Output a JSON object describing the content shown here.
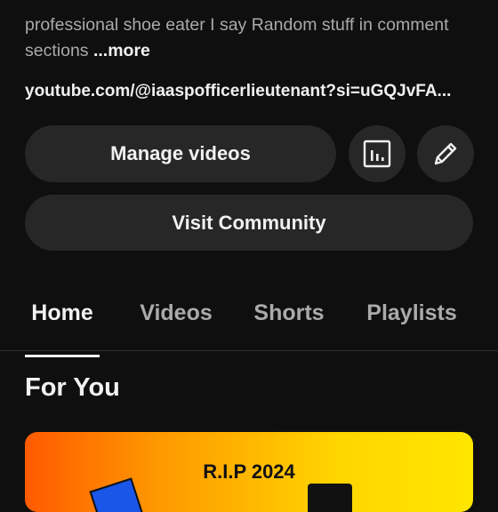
{
  "channel": {
    "description": "professional shoe eater I say Random stuff in comment sections",
    "more_label": "...more",
    "link": "youtube.com/@iaaspofficerlieutenant?si=uGQJvFA..."
  },
  "actions": {
    "manage_videos": "Manage videos",
    "visit_community": "Visit Community",
    "analytics_icon": "bar-chart-icon",
    "edit_icon": "pencil-icon"
  },
  "tabs": [
    {
      "label": "Home",
      "active": true
    },
    {
      "label": "Videos",
      "active": false
    },
    {
      "label": "Shorts",
      "active": false
    },
    {
      "label": "Playlists",
      "active": false
    }
  ],
  "section": {
    "title": "For You"
  },
  "video": {
    "thumbnail_text": "R.I.P 2024"
  },
  "colors": {
    "background": "#0f0f0f",
    "button": "#272727",
    "text": "#f1f1f1",
    "muted": "#aaaaaa"
  }
}
